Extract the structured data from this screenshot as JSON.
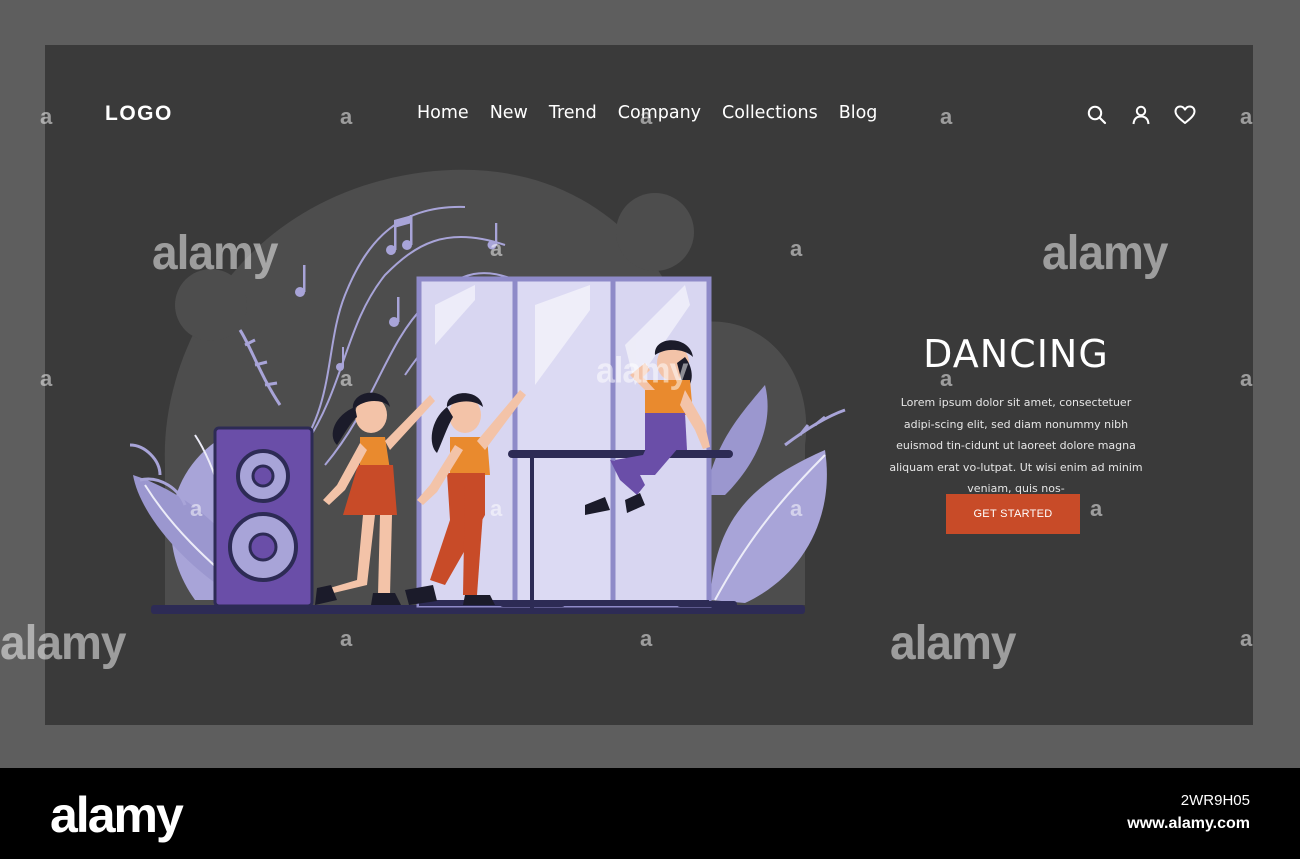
{
  "header": {
    "logo": "LOGO",
    "nav": [
      "Home",
      "New",
      "Trend",
      "Company",
      "Collections",
      "Blog"
    ]
  },
  "icons": [
    "search-icon",
    "user-icon",
    "heart-icon"
  ],
  "hero": {
    "title": "DANCING",
    "body": "Lorem ipsum dolor sit amet, consectetuer adipi-scing elit, sed diam nonummy nibh euismod tin-cidunt ut laoreet dolore magna aliquam erat vo-lutpat. Ut wisi enim ad minim veniam, quis nos-",
    "cta_label": "GET STARTED"
  },
  "watermark": {
    "word": "alamy",
    "letter": "a"
  },
  "footer": {
    "brand": "alamy",
    "image_id": "2WR9H05",
    "url": "www.alamy.com"
  },
  "colors": {
    "page_bg": "#5e5e5e",
    "panel_bg": "#3a3a3a",
    "accent": "#c84b28",
    "illustration_purple": "#6a4ea8",
    "illustration_lavender": "#a8a4d8",
    "outfit_orange": "#e98a2e"
  }
}
